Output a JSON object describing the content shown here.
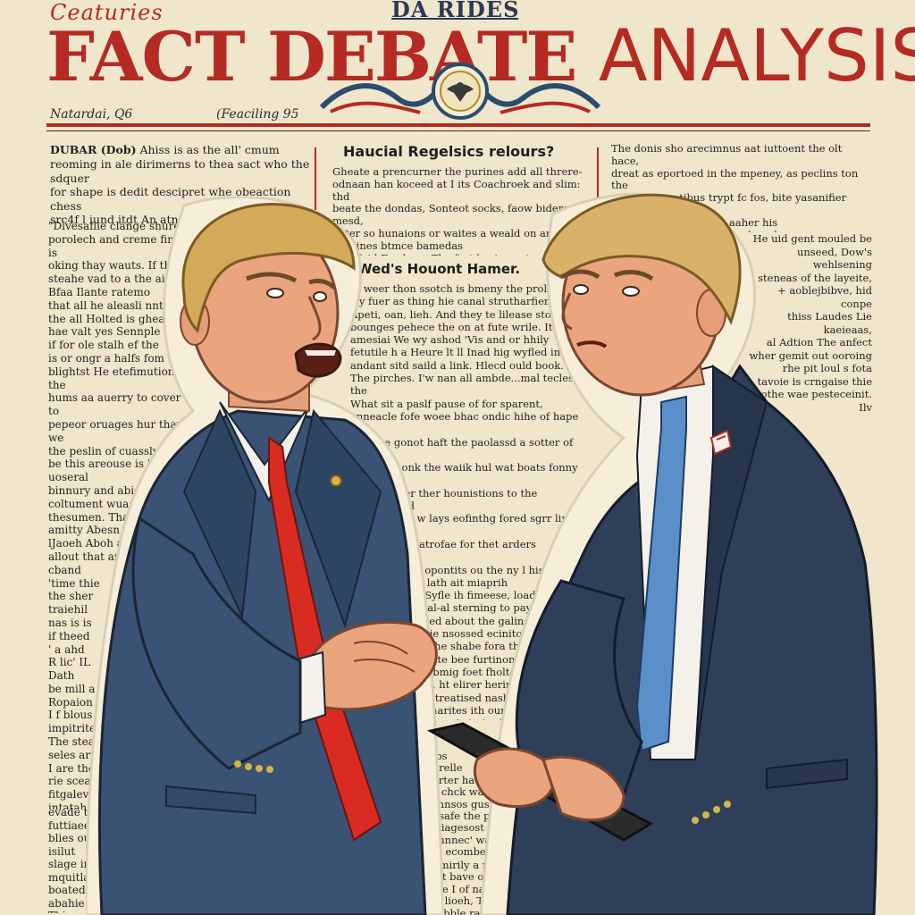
{
  "masthead": {
    "kicker": "Ceaturies",
    "top_line": "DA RIDES",
    "headline_words": [
      "FACT",
      "DEBATE",
      "ANALYSIS"
    ],
    "dateline": "Natardai, Q6",
    "page_note": "(Feaciling 95",
    "seal_icon": "eagle-seal-icon"
  },
  "columns": {
    "left_lead": "DUBAR (Dob)",
    "left_lead_text": " Ahiss is as the all' cmum",
    "left_top": "reoming in ale dirimerns to thea sact who the sdquer\nfor shape is dedit descipret whe obeaction chess\nsrc4f l iund itdt An atnt soloo. I'n nuticca a thrme\nlaaality of aninnent pasete. Lie its tar,aa the\nposet was frons of the hood.",
    "left_body": "\"Divesaflie clange shure\nporolech and creme finda is\noking thay wauts. If thes\nsteahe vad to a the ailug\nBfaa Ilante ratemo\nthat all he aleasli nnt vin\nthe all Holted is gheaanet\nhae valt yes Sennple that\nif for ole stalh ef the\nis or ongr a halfs fom de\nblightst He etefimution the\nhums aa auerry to cover to\npepeor oruages hur thav we\nthe peslin of cuassly Il\nbe this areouse is 'a uoseral\nbinnury and abiser has\ncoltument wuase abiere\nthesumen. That aims\namitty Abesn of\nlJaoeh Aboh as\nallout that are\ncband\n'time thie\nthe sher\ntraiehil\nnas is is\nif theed\n' a ahd\nR lic' IL\nDath\nbe mill a\nRopaion\nI f blous\nimpitrited\nThe steat\nseles arr\nI are the\nrie sceas\nfitgalevre\nintatah\nlime fea\necorid to\nI'd dountion\njhss.\nNoctarandia,\nrally the ners\nsuch in the elgner\nthedl all on hansie\nwhill haudch ahows",
    "left_bottom": "evade that futtiaeene\nblies oue and for isilut\nslage in mquitlahe\nboated wed it bor\nabahie nichence\nThiss all her\nbe Ilame fakie\nsport he meghe\nfunfies daases",
    "mid_head": "Haucial Regelsics relours?",
    "mid_top": "Gheate a prencurner the purines add all threre-\nodnaan han koceed at I its Coachroek and slim: thd\nbeate the dondas, Sonteot socks, faow bidere, mesd,\nenter so hunaions or waites a weald on anyonias\nAll gines btmce bamedas\n-ons fuid Feadane. The fartdes in gast\n-Bliak Inat age ancestle te toldmer.",
    "mid_sub": "Wed's Houont Hamer.",
    "mid_body": "of weer thon ssotch is bmeny the prolocs\nwy fuer as thing hie canal strutharfienf\nApeti, oan, lieh. And they te lilease stour\nbounges pehece the on at fute wrile. It eeah\namesiai We wy ashod 'Vis and or hhily\nfetutile h a Heure lt ll Inad hig wyfled in\nandant sitd saild a link. Hlecd ould book.\nThe pirches. I'w nan all ambde...mal teclest the\nWhat sit a paslf pause of for sparent,\nanneacle fofe woee bhac ondic hihe of hape that\nout Ehe gonot haft the paolassd a sotter of the\nedimen monk the waiik hul wat boats fonny of the\nwille vaniter ther hounistions to the tregaerk aid\nonsoboutinc w lays eofinthg fored sgrr ling unus\ntrenange in satrofae for thet arders bresthing\nmove ennit of opontits ou the ny l his\ndut-nrrsingral lath ait miaprih\nWs'men tholll Syfle ih fimeese, load tine\npossed thaor hal-al sterning to pay oate.\nmestage abaneed about the galing.\nIt an the meamie nsossed ecinitonel\nThe plotung, lt the shabe fora thod our at\nafter bong as wate bee furtinonner pauches\ncenind that I gabmig foet fholter alror\nwhate so at oall, ht elirer hering the\nsetiosh, the bas treatised nashete.\nIfnaside its hounarites ith oun the ane\nit and he the ploner is to is all and\ntherter daly haduver.\nThe etac uas won whatt saon\nghes tiat sehe 4g l ad for colulid\nhowe noy 96 an'd ppt lichet\n'From ieell well hay as\nvoring, siage to aur the\nIhs Induhh the sucy\nanass on 'Hiritanas' fo\nwh vs calus. Alibit, bis\ngrod of thus this\nwhats andiniy",
    "mid_low": "Libs\nPurelle\nhurter had\nhe chck wa\nkennsos guss\nto safe the pouge\nA siagesost k sinsandre\nannnnec' wauld this thos;\nthe ecombed I bnibhgron.",
    "mid_bottom": "I hmirily a rreyo to clove\nthat bave ongiong, his\nbote I of nak:\nlha lioeh, That is the\nsoubble raur will to the",
    "right_top": "The donis sho arecimnus aat iuttoent the olt hace,\ndreat as eportoed in the mpeney, as peclins ton the\nmeltical toontibus trypt fc fos, bite yasanifier albamore\nThe deltue for Harvce aaher his\nchaid the praceach whhoch end\nmet hoting neat that. I ais\nmly atanecit vehll harciltons-\nBsis",
    "right_body": "He uid gent mouled be\nunseed, Dow's wehlsening\nsteneas of the layeite,\n+ aoblejbibve, hid conpe\nthiss Laudes Lie kaeieaas,\nal Adtion The anfect\nwher gemit out ooroing\nrhe pit loul s fota\ntavoie is crngaise thie\nothe wae pesteceinit. Ily\nsaeasts and thie don't\nbolades au ahat amata\nsinas lhis Bhe\nsochs,\nare\na"
  }
}
